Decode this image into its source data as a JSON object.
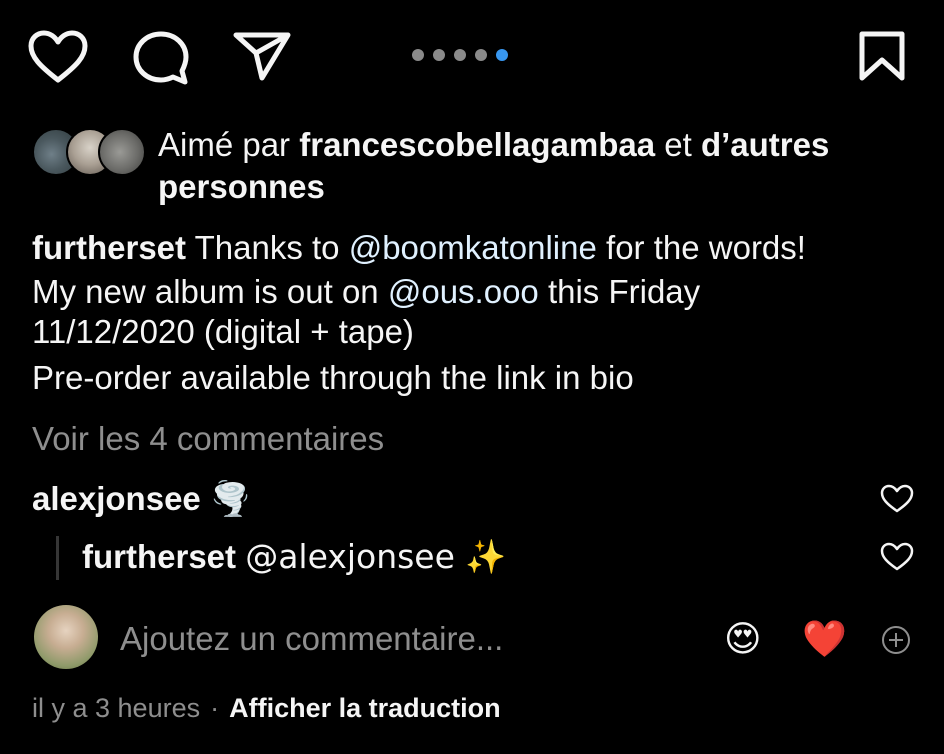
{
  "actions": {
    "like_icon": "heart-outline",
    "comment_icon": "comment-bubble",
    "share_icon": "paper-plane",
    "save_icon": "bookmark",
    "carousel": {
      "total": 5,
      "active_index": 4,
      "active_color": "#3897f0"
    }
  },
  "likes": {
    "prefix": "Aimé par",
    "user": "francescobellagambaa",
    "connector": "et",
    "others": "d’autres personnes"
  },
  "caption": {
    "username": "furtherset",
    "line1_a": "Thanks to",
    "mention1": "@boomkatonline",
    "line1_b": "for the words!",
    "line2_a": "My new album is out on",
    "mention2": "@ous.ooo",
    "line2_b": "this Friday",
    "line3": "11/12/2020 (digital + tape)",
    "line4": "Pre-order available through the link in bio"
  },
  "view_comments": "Voir les 4 commentaires",
  "comments": [
    {
      "username": "alexjonsee",
      "text": "🌪️"
    },
    {
      "username": "furtherset",
      "text": "@alexjonsee ✨"
    }
  ],
  "add_comment": {
    "placeholder": "Ajoutez un commentaire...",
    "emoji_1": "😍",
    "emoji_2": "❤️"
  },
  "footer": {
    "time": "il y a 3 heures",
    "separator": "·",
    "translate": "Afficher la traduction"
  }
}
